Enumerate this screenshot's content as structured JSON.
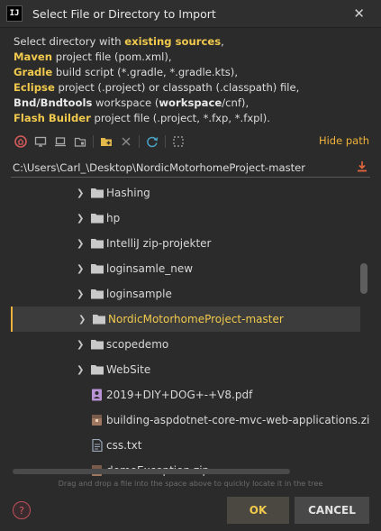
{
  "window": {
    "title": "Select File or Directory to Import",
    "app_icon": "IJ"
  },
  "description": [
    [
      {
        "t": "Select directory with ",
        "b": false
      },
      {
        "t": "existing sources",
        "b": true
      },
      {
        "t": ",",
        "b": false
      }
    ],
    [
      {
        "t": "Maven",
        "b": true
      },
      {
        "t": " project file (pom.xml),",
        "b": false
      }
    ],
    [
      {
        "t": "Gradle",
        "b": true
      },
      {
        "t": " build script (*.gradle, *.gradle.kts),",
        "b": false
      }
    ],
    [
      {
        "t": "Eclipse",
        "b": true
      },
      {
        "t": " project (.project) or classpath (.classpath) file,",
        "b": false
      }
    ],
    [
      {
        "t": "Bnd/Bndtools",
        "b": "white"
      },
      {
        "t": " workspace (",
        "b": false
      },
      {
        "t": "workspace",
        "b": "white"
      },
      {
        "t": "/cnf),",
        "b": false
      }
    ],
    [
      {
        "t": "Flash Builder",
        "b": true
      },
      {
        "t": " project file (.project, *.fxp, *.fxpl).",
        "b": false
      }
    ]
  ],
  "toolbar": {
    "hide_path_label": "Hide path"
  },
  "path": {
    "value": "C:\\Users\\Carl_\\Desktop\\NordicMotorhomeProject-master"
  },
  "tree": [
    {
      "name": "Hashing",
      "type": "folder",
      "expandable": true,
      "selected": false
    },
    {
      "name": "hp",
      "type": "folder",
      "expandable": true,
      "selected": false
    },
    {
      "name": "IntelliJ zip-projekter",
      "type": "folder",
      "expandable": true,
      "selected": false
    },
    {
      "name": "loginsamle_new",
      "type": "folder",
      "expandable": true,
      "selected": false
    },
    {
      "name": "loginsample",
      "type": "folder",
      "expandable": true,
      "selected": false
    },
    {
      "name": "NordicMotorhomeProject-master",
      "type": "folder",
      "expandable": true,
      "selected": true
    },
    {
      "name": "scopedemo",
      "type": "folder",
      "expandable": true,
      "selected": false
    },
    {
      "name": "WebSite",
      "type": "folder",
      "expandable": true,
      "selected": false
    },
    {
      "name": "2019+DIY+DOG+-+V8.pdf",
      "type": "pdf",
      "expandable": false,
      "selected": false
    },
    {
      "name": "building-aspdotnet-core-mvc-web-applications.zip",
      "type": "zip",
      "expandable": false,
      "selected": false
    },
    {
      "name": "css.txt",
      "type": "txt",
      "expandable": false,
      "selected": false
    },
    {
      "name": "demoException.zip",
      "type": "zip",
      "expandable": false,
      "selected": false
    }
  ],
  "hint": "Drag and drop a file into the space above to quickly locate it in the tree",
  "buttons": {
    "ok": "OK",
    "cancel": "CANCEL"
  },
  "colors": {
    "accent": "#f0c94d",
    "background": "#2b2b2b",
    "selection": "#3c3c3c"
  }
}
